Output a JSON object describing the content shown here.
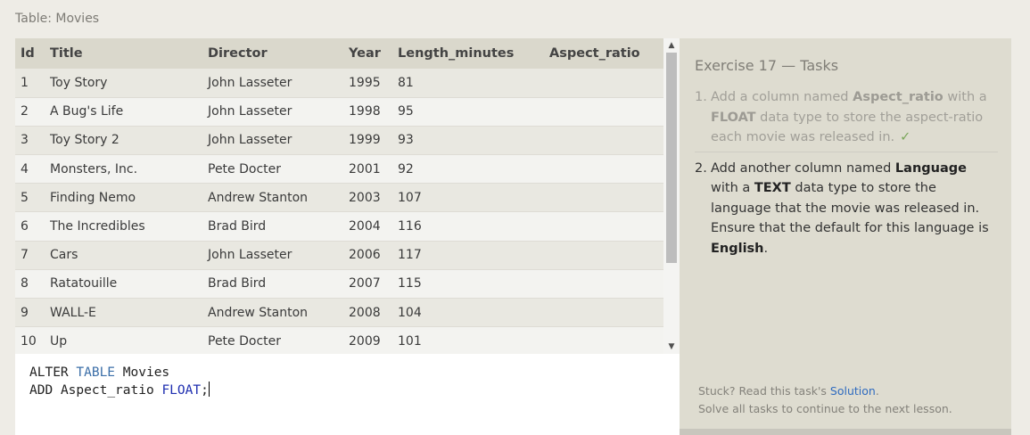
{
  "table_caption": "Table: Movies",
  "table": {
    "columns": [
      "Id",
      "Title",
      "Director",
      "Year",
      "Length_minutes",
      "Aspect_ratio"
    ],
    "rows": [
      [
        "1",
        "Toy Story",
        "John Lasseter",
        "1995",
        "81",
        ""
      ],
      [
        "2",
        "A Bug's Life",
        "John Lasseter",
        "1998",
        "95",
        ""
      ],
      [
        "3",
        "Toy Story 2",
        "John Lasseter",
        "1999",
        "93",
        ""
      ],
      [
        "4",
        "Monsters, Inc.",
        "Pete Docter",
        "2001",
        "92",
        ""
      ],
      [
        "5",
        "Finding Nemo",
        "Andrew Stanton",
        "2003",
        "107",
        ""
      ],
      [
        "6",
        "The Incredibles",
        "Brad Bird",
        "2004",
        "116",
        ""
      ],
      [
        "7",
        "Cars",
        "John Lasseter",
        "2006",
        "117",
        ""
      ],
      [
        "8",
        "Ratatouille",
        "Brad Bird",
        "2007",
        "115",
        ""
      ],
      [
        "9",
        "WALL-E",
        "Andrew Stanton",
        "2008",
        "104",
        ""
      ],
      [
        "10",
        "Up",
        "Pete Docter",
        "2009",
        "101",
        ""
      ]
    ]
  },
  "editor": {
    "line1_kw_alter": "ALTER",
    "line1_kw_table": "TABLE",
    "line1_name": "Movies",
    "line2_kw_add": "ADD",
    "line2_col": "Aspect_ratio",
    "line2_type": "FLOAT",
    "line2_end": ";"
  },
  "exercise": {
    "title": "Exercise 17 — Tasks",
    "task1": {
      "num": "1.",
      "pre": "Add a column named ",
      "b1": "Aspect_ratio",
      "mid": " with a ",
      "b2": "FLOAT",
      "post": " data type to store the aspect-ratio each movie was released in.",
      "check": "✓"
    },
    "task2": {
      "num": "2.",
      "pre": "Add another column named ",
      "b1": "Language",
      "mid": " with a ",
      "b2": "TEXT",
      "mid2": " data type to store the language that the movie was released in. Ensure that the default for this language is ",
      "b3": "English",
      "post": "."
    }
  },
  "footer": {
    "stuck_pre": "Stuck? Read this task's ",
    "solution_link": "Solution",
    "stuck_post": ".",
    "line2": "Solve all tasks to continue to the next lesson."
  },
  "icons": {
    "scroll_up": "▲",
    "scroll_down": "▼"
  }
}
